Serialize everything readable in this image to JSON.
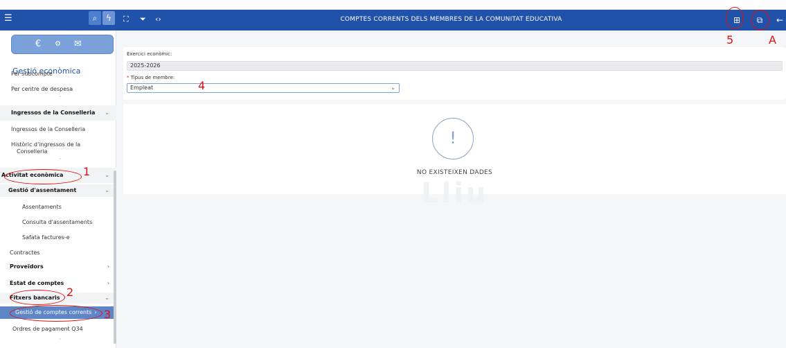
{
  "window": {
    "title": "COMPTES CORRENTS DELS MEMBRES DE LA COMUNITAT EDUCATIVA"
  },
  "sidebar": {
    "module_title": "Gestió econòmica",
    "items": [
      {
        "label": "Per subcompte"
      },
      {
        "label": "Per centre de despesa"
      },
      {
        "label": "Ingressos de la Conselleria"
      },
      {
        "label": "Ingressos de la Conselleria"
      },
      {
        "label": "Històric d'ingressos de la"
      },
      {
        "label": "Conselleria"
      },
      {
        "label": "Activitat econòmica"
      },
      {
        "label": "Gestió d'assentament"
      },
      {
        "label": "Assentaments"
      },
      {
        "label": "Consulta d'assentaments"
      },
      {
        "label": "Safata factures-e"
      },
      {
        "label": "Contractes"
      },
      {
        "label": "Proveïdors"
      },
      {
        "label": "Estat de comptes"
      },
      {
        "label": "Fitxers bancaris"
      },
      {
        "label": "Gestió de comptes corrents"
      },
      {
        "label": "Ordres de pagament Q34"
      }
    ]
  },
  "form": {
    "exercise_label": "Exercici econòmic:",
    "exercise_value": "2025-2026",
    "member_type_label": "Tipus de membre:",
    "member_type_required": "*",
    "member_type_value": "Empleat"
  },
  "empty_state": {
    "icon": "!",
    "message": "NO EXISTEIXEN DADES",
    "watermark": "Lliu"
  },
  "annotations": [
    "1",
    "2",
    "3",
    "4",
    "5",
    "A"
  ],
  "colors": {
    "primary": "#1f52a8",
    "active_item": "#5e86c6",
    "annotation": "#e01010"
  }
}
